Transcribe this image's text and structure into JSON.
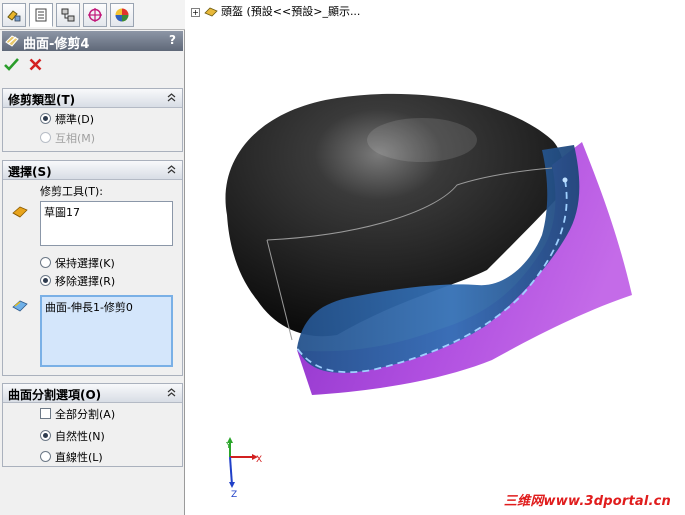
{
  "tabs": [
    "feature-manager",
    "property-manager",
    "configuration-manager",
    "dimxpert-manager",
    "display-manager"
  ],
  "pm": {
    "title": "曲面-修剪4",
    "help": "?",
    "ok_icon": "check-icon",
    "cancel_icon": "x-icon"
  },
  "trim_type": {
    "header": "修剪類型(T)",
    "standard": "標準(D)",
    "mutual": "互相(M)"
  },
  "selections": {
    "header": "選擇(S)",
    "trim_tool_label": "修剪工具(T):",
    "trim_tool_value": "草圖17",
    "keep": "保持選擇(K)",
    "remove": "移除選擇(R)",
    "pieces_value": "曲面-伸長1-修剪0"
  },
  "split_options": {
    "header": "曲面分割選項(O)",
    "split_all": "全部分割(A)",
    "natural": "自然性(N)",
    "linear": "直線性(L)"
  },
  "viewport": {
    "tree_text": "頭盔 (預設<<預設>_顯示...",
    "axis_x": "X",
    "axis_y": "Y",
    "axis_z": "Z",
    "watermark": "三维网www.3dportal.cn",
    "colors": {
      "body": "#1e1e1e",
      "surface_blue": "#2d5f9c",
      "surface_purple": "#a24ad6"
    }
  }
}
